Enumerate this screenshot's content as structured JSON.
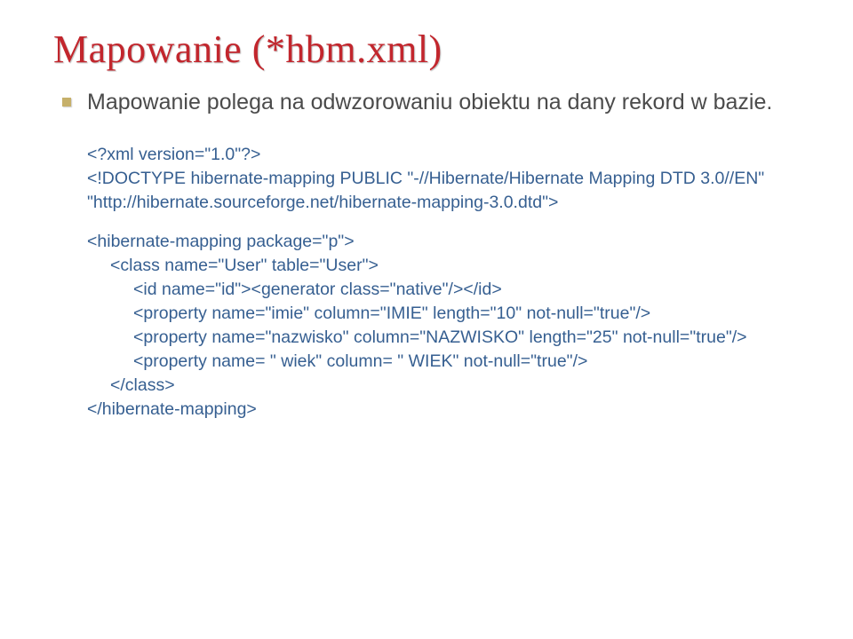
{
  "title": "Mapowanie (*hbm.xml)",
  "intro": "Mapowanie polega na odwzorowaniu obiektu na dany rekord w bazie.",
  "code": {
    "l1": "<?xml version=\"1.0\"?>",
    "l2": "<!DOCTYPE hibernate-mapping PUBLIC \"-//Hibernate/Hibernate Mapping DTD 3.0//EN\"",
    "l3": "\"http://hibernate.sourceforge.net/hibernate-mapping-3.0.dtd\">",
    "l4": "<hibernate-mapping package=\"p\">",
    "l5": "<class name=\"User\" table=\"User\">",
    "l6": "<id name=\"id\"><generator class=\"native\"/></id>",
    "l7": "<property name=\"imie\" column=\"IMIE\" length=\"10\" not-null=\"true\"/>",
    "l8": "<property name=\"nazwisko\" column=\"NAZWISKO\" length=\"25\" not-null=\"true\"/>",
    "l9": "<property name= \" wiek\" column= \" WIEK\" not-null=\"true\"/>",
    "l10": "</class>",
    "l11": "</hibernate-mapping>"
  }
}
